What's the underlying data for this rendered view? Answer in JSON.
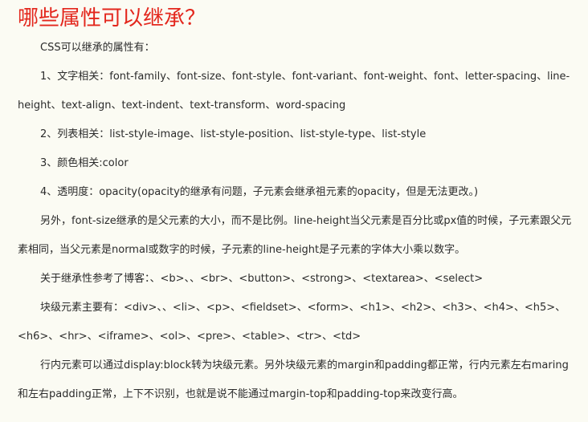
{
  "heading": "哪些属性可以继承？",
  "paragraphs": [
    "CSS可以继承的属性有：",
    "1、文字相关：font-family、font-size、font-style、font-variant、font-weight、font、letter-spacing、line-height、text-align、text-indent、text-transform、word-spacing",
    "2、列表相关：list-style-image、list-style-position、list-style-type、list-style",
    "3、颜色相关:color",
    "4、透明度：opacity(opacity的继承有问题，子元素会继承祖元素的opacity，但是无法更改。)",
    "另外，font-size继承的是父元素的大小，而不是比例。line-height当父元素是百分比或px值的时候，子元素跟父元素相同，当父元素是normal或数字的时候，子元素的line-height是子元素的字体大小乘以数字。",
    "关于继承性参考了博客：、<b>、、<br>、<button>、<strong>、<textarea>、<select>",
    "块级元素主要有：<div>、、<li>、<p>、<fieldset>、<form>、<h1>、<h2>、<h3>、<h4>、<h5>、<h6>、<hr>、<iframe>、<ol>、<pre>、<table>、<tr>、<td>",
    "行内元素可以通过display:block转为块级元素。另外块级元素的margin和padding都正常，行内元素左右maring和左右padding正常，上下不识别，也就是说不能通过margin-top和padding-top来改变行高。"
  ]
}
